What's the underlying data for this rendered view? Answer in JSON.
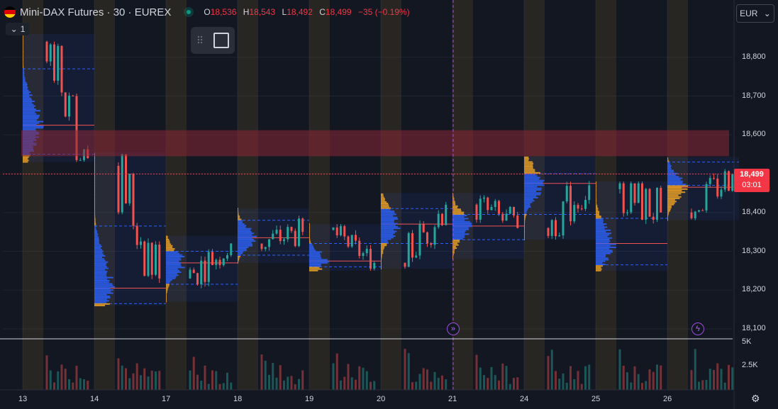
{
  "header": {
    "symbol": "Mini-DAX Futures · 30 · EUREX",
    "open_label": "O",
    "open": "18,536",
    "high_label": "H",
    "high": "18,543",
    "low_label": "L",
    "low": "18,492",
    "close_label": "C",
    "close": "18,499",
    "change": "−35 (−0.19%)"
  },
  "indicator_toggle": {
    "label": "1"
  },
  "currency": {
    "label": "EUR"
  },
  "price_axis": {
    "labels": [
      "18,800",
      "18,700",
      "18,600",
      "18,400",
      "18,300",
      "18,200",
      "18,100"
    ],
    "last_price": "18,499",
    "countdown": "03:01"
  },
  "volume_axis": {
    "labels": [
      "5K",
      "2.5K"
    ]
  },
  "time_axis": {
    "labels": [
      "13",
      "14",
      "17",
      "18",
      "19",
      "20",
      "21",
      "24",
      "25",
      "26"
    ]
  },
  "colors": {
    "background": "#131722",
    "up": "#26a69a",
    "down": "#ef5350",
    "profile_blue": "#2962ff",
    "profile_orange": "#f5a623",
    "zone": "#8b2635",
    "event": "#9c4dde"
  },
  "chart_data": {
    "type": "candlestick",
    "instrument": "Mini-DAX Futures",
    "timeframe": "30",
    "exchange": "EUREX",
    "ylim": [
      18080,
      18860
    ],
    "y_ticks": [
      18100,
      18200,
      18300,
      18400,
      18500,
      18600,
      18700,
      18800
    ],
    "sessions": [
      {
        "day": "13",
        "open": 18840,
        "high": 18860,
        "low": 18530,
        "close": 18540,
        "poc": 18625,
        "vah": 18770,
        "val": 18550
      },
      {
        "day": "14",
        "open": 18520,
        "high": 18555,
        "low": 18160,
        "close": 18230,
        "poc": 18205,
        "vah": 18365,
        "val": 18165
      },
      {
        "day": "17",
        "open": 18230,
        "high": 18340,
        "low": 18170,
        "close": 18320,
        "poc": 18270,
        "vah": 18300,
        "val": 18215
      },
      {
        "day": "18",
        "open": 18320,
        "high": 18410,
        "low": 18270,
        "close": 18350,
        "poc": 18335,
        "vah": 18380,
        "val": 18290
      },
      {
        "day": "19",
        "open": 18355,
        "high": 18370,
        "low": 18250,
        "close": 18270,
        "poc": 18275,
        "vah": 18320,
        "val": 18260
      },
      {
        "day": "20",
        "open": 18270,
        "high": 18450,
        "low": 18255,
        "close": 18420,
        "poc": 18370,
        "vah": 18410,
        "val": 18320
      },
      {
        "day": "21",
        "open": 18420,
        "high": 18450,
        "low": 18280,
        "close": 18360,
        "poc": 18365,
        "vah": 18395,
        "val": 18330
      },
      {
        "day": "24",
        "open": 18360,
        "high": 18545,
        "low": 18330,
        "close": 18470,
        "poc": 18475,
        "vah": 18500,
        "val": 18395
      },
      {
        "day": "25",
        "open": 18460,
        "high": 18480,
        "low": 18250,
        "close": 18400,
        "poc": 18320,
        "vah": 18385,
        "val": 18265
      },
      {
        "day": "26",
        "open": 18400,
        "high": 18543,
        "low": 18380,
        "close": 18499,
        "poc": 18465,
        "vah": 18530,
        "val": 18470
      }
    ],
    "zone": {
      "from": 18545,
      "to": 18612
    },
    "last_price": 18499,
    "volume_ylim": [
      0,
      5000
    ]
  }
}
